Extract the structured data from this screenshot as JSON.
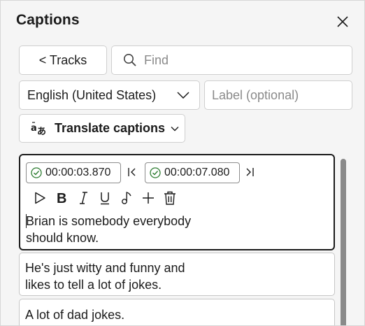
{
  "panel": {
    "title": "Captions",
    "close_icon": "close-icon"
  },
  "toolbar": {
    "tracks_label": "< Tracks",
    "find_placeholder": "Find"
  },
  "language": {
    "selected": "English (United States)",
    "label_placeholder": "Label (optional)"
  },
  "translate": {
    "label": "Translate captions"
  },
  "captions": [
    {
      "start": "00:00:03.870",
      "end": "00:00:07.080",
      "text": "Brian is somebody everybody\nshould know.",
      "active": true
    },
    {
      "text": "He's just witty and funny and\nlikes to tell a lot of jokes."
    },
    {
      "text": "A lot of dad jokes."
    }
  ],
  "format_icons": [
    "play-icon",
    "bold-icon",
    "italic-icon",
    "underline-icon",
    "music-note-icon",
    "add-icon",
    "delete-icon"
  ]
}
